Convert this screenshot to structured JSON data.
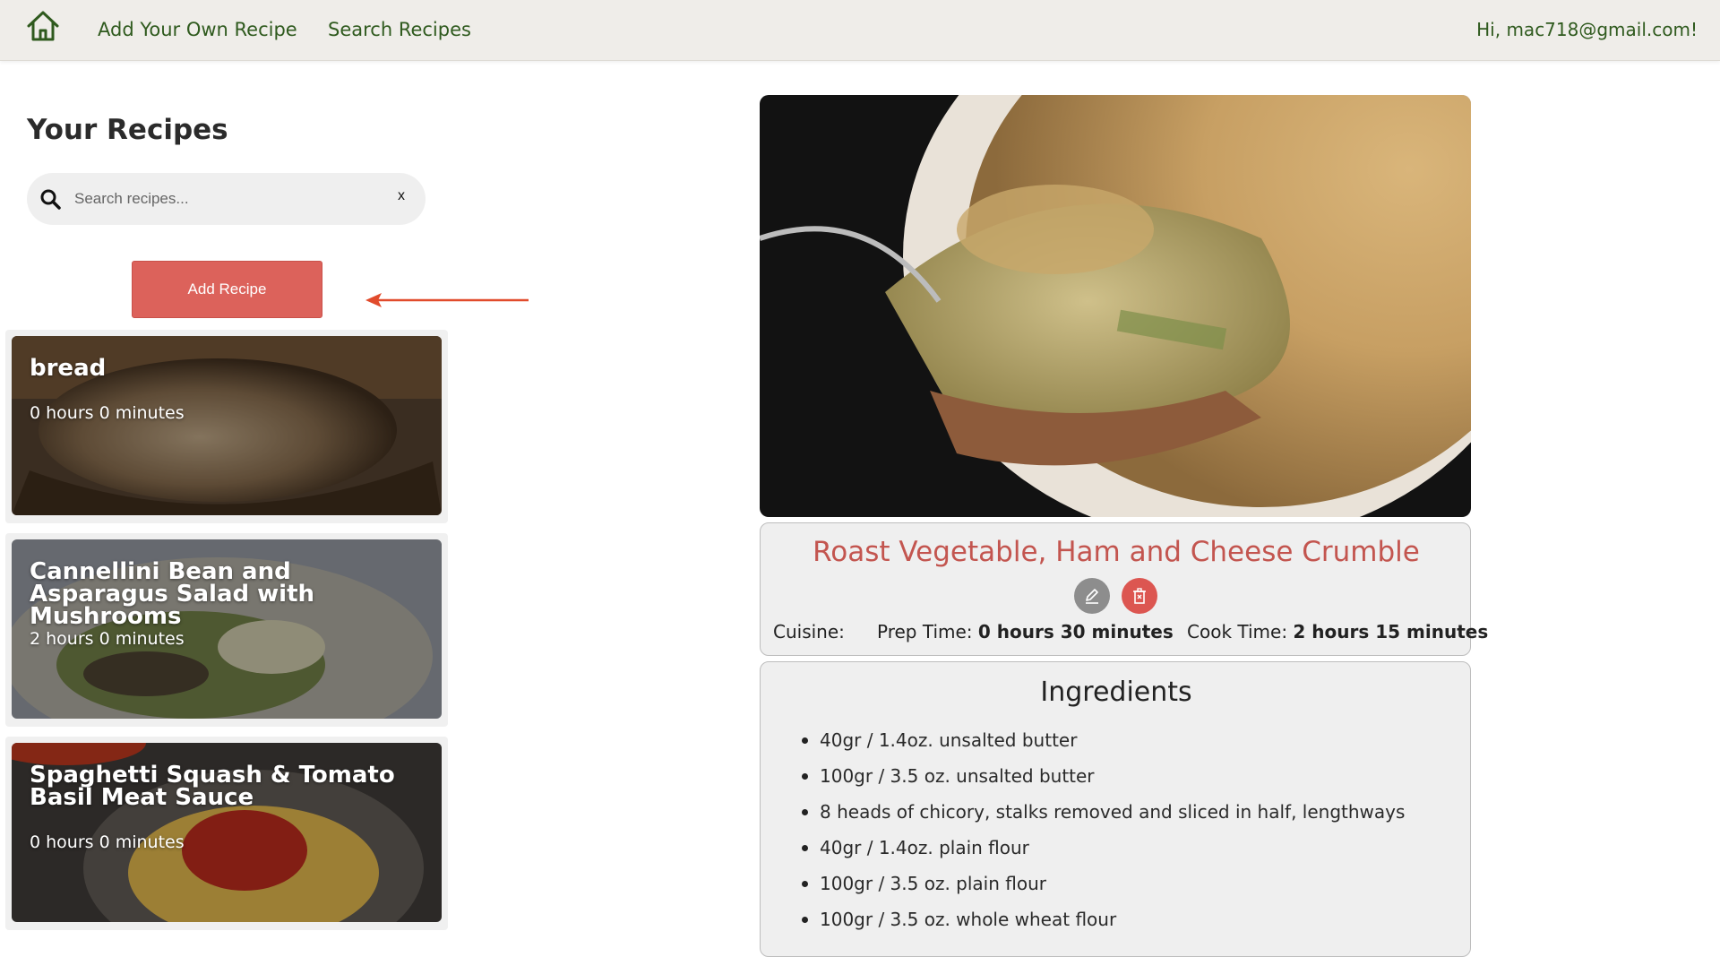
{
  "nav": {
    "home_icon": "home-icon",
    "add_recipe_link": "Add Your Own Recipe",
    "search_recipes_link": "Search Recipes",
    "greeting": "Hi, mac718@gmail.com!"
  },
  "sidebar": {
    "title": "Your Recipes",
    "search": {
      "placeholder": "Search recipes...",
      "value": "",
      "clear_label": "x"
    },
    "add_button_label": "Add Recipe",
    "recipes": [
      {
        "title": "bread",
        "time": "0 hours 0 minutes"
      },
      {
        "title": "Cannellini Bean and Asparagus Salad with Mushrooms",
        "time": "2 hours 0 minutes"
      },
      {
        "title": "Spaghetti Squash & Tomato Basil Meat Sauce",
        "time": "0 hours 0 minutes"
      }
    ]
  },
  "recipe": {
    "title": "Roast Vegetable, Ham and Cheese Crumble",
    "cuisine_label": "Cuisine:",
    "cuisine_value": "",
    "prep_label": "Prep Time:",
    "prep_value": "0 hours 30 minutes",
    "cook_label": "Cook Time:",
    "cook_value": "2 hours 15 minutes",
    "ingredients_title": "Ingredients",
    "ingredients": [
      "40gr / 1.4oz. unsalted butter",
      "100gr / 3.5 oz. unsalted butter",
      "8 heads of chicory, stalks removed and sliced in half, lengthways",
      "40gr / 1.4oz. plain flour",
      "100gr / 3.5 oz. plain flour",
      "100gr / 3.5 oz. whole wheat flour"
    ]
  },
  "colors": {
    "nav_bg": "#efede9",
    "nav_text": "#2f5a1e",
    "accent_red": "#dc625b",
    "recipe_title": "#c3554f",
    "edit_gray": "#8d8d8d"
  }
}
